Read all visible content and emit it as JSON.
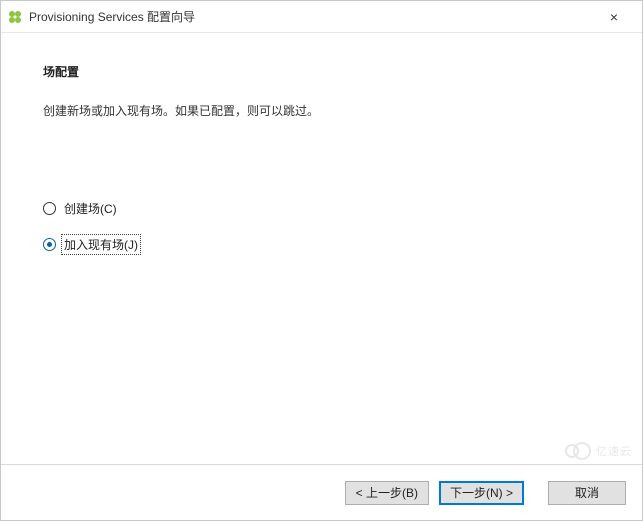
{
  "window": {
    "title": "Provisioning Services 配置向导",
    "close_label": "×"
  },
  "page": {
    "heading": "场配置",
    "description": "创建新场或加入现有场。如果已配置，则可以跳过。"
  },
  "options": {
    "create": {
      "label": "创建场(C)",
      "selected": false
    },
    "join": {
      "label": "加入现有场(J)",
      "selected": true
    }
  },
  "buttons": {
    "back": "< 上一步(B)",
    "next": "下一步(N) >",
    "cancel": "取消"
  },
  "watermark": {
    "text": "亿速云"
  }
}
